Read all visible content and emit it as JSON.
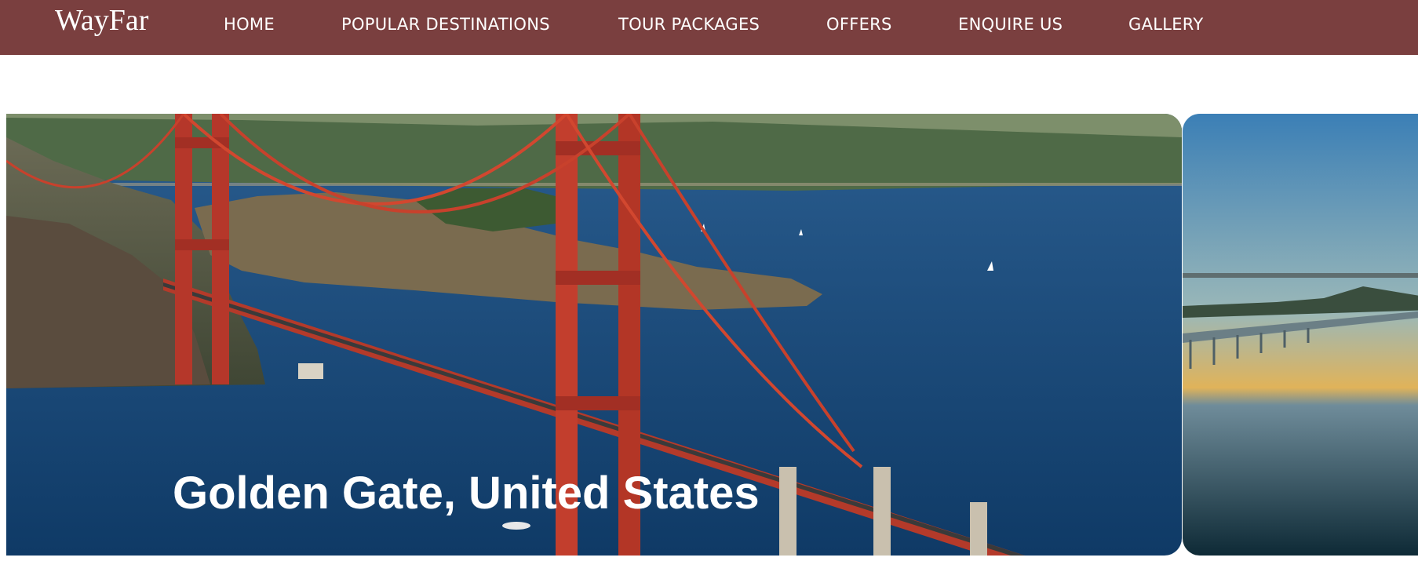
{
  "brand": "WayFar",
  "nav": [
    {
      "label": "HOME"
    },
    {
      "label": "POPULAR DESTINATIONS"
    },
    {
      "label": "TOUR PACKAGES"
    },
    {
      "label": "OFFERS"
    },
    {
      "label": "ENQUIRE US"
    },
    {
      "label": "GALLERY"
    }
  ],
  "slides": [
    {
      "caption": "Golden Gate, United States"
    },
    {
      "caption": ""
    }
  ],
  "colors": {
    "navbar": "#7a3f3f",
    "text": "#ffffff"
  }
}
